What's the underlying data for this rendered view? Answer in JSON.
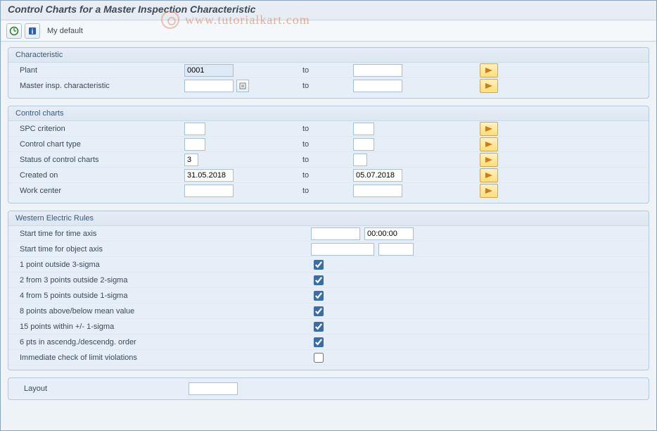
{
  "title": "Control Charts for a Master Inspection Characteristic",
  "watermark": "www.tutorialkart.com",
  "toolbar": {
    "my_default": "My default"
  },
  "groups": {
    "characteristic": {
      "title": "Characteristic",
      "rows": {
        "plant": {
          "label": "Plant",
          "from": "0001",
          "to_label": "to",
          "to": ""
        },
        "mic": {
          "label": "Master insp. characteristic",
          "from": "",
          "to_label": "to",
          "to": ""
        }
      }
    },
    "control_charts": {
      "title": "Control charts",
      "rows": {
        "spc": {
          "label": "SPC criterion",
          "from": "",
          "to_label": "to",
          "to": ""
        },
        "cctype": {
          "label": "Control chart type",
          "from": "",
          "to_label": "to",
          "to": ""
        },
        "status": {
          "label": "Status of control charts",
          "from": "3",
          "to_label": "to",
          "to": ""
        },
        "created": {
          "label": "Created on",
          "from": "31.05.2018",
          "to_label": "to",
          "to": "05.07.2018"
        },
        "wc": {
          "label": "Work center",
          "from": "",
          "to_label": "to",
          "to": ""
        }
      }
    },
    "wer": {
      "title": "Western Electric Rules",
      "start_time_axis": {
        "label": "Start time for time axis",
        "val1": "",
        "val2": "00:00:00"
      },
      "start_obj_axis": {
        "label": "Start time for object axis",
        "val1": "",
        "val2": ""
      },
      "checks": {
        "r1": {
          "label": "1 point outside 3-sigma",
          "checked": true
        },
        "r2": {
          "label": "2 from 3 points outside 2-sigma",
          "checked": true
        },
        "r3": {
          "label": "4 from 5 points outside 1-sigma",
          "checked": true
        },
        "r4": {
          "label": "8 points above/below mean value",
          "checked": true
        },
        "r5": {
          "label": "15 points within +/- 1-sigma",
          "checked": true
        },
        "r6": {
          "label": "6 pts in ascendg./descendg. order",
          "checked": true
        },
        "r7": {
          "label": "Immediate check of limit violations",
          "checked": false
        }
      }
    }
  },
  "layout": {
    "label": "Layout",
    "value": ""
  }
}
